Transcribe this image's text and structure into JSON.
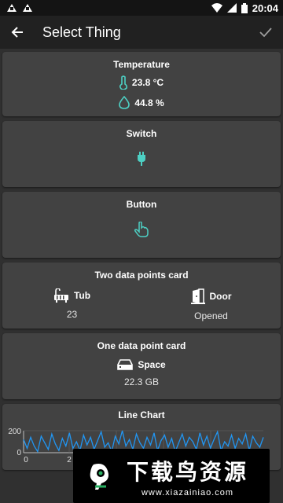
{
  "status_bar": {
    "time": "20:04"
  },
  "app_bar": {
    "title": "Select Thing",
    "back_icon": "arrow-left-icon",
    "confirm_icon": "check-icon"
  },
  "cards": {
    "temperature": {
      "title": "Temperature",
      "temp_value": "23.8 °C",
      "humidity_value": "44.8 %"
    },
    "switch": {
      "title": "Switch"
    },
    "button": {
      "title": "Button"
    },
    "two_points": {
      "title": "Two data points card",
      "left_label": "Tub",
      "left_value": "23",
      "right_label": "Door",
      "right_value": "Opened"
    },
    "one_point": {
      "title": "One data point card",
      "label": "Space",
      "value": "22.3 GB"
    },
    "line_chart": {
      "title": "Line Chart"
    }
  },
  "colors": {
    "accent": "#4dd0c4",
    "chart_line": "#2196f3"
  },
  "chart_data": {
    "type": "line",
    "title": "Line Chart",
    "ylim": [
      0,
      200
    ],
    "y_ticks": [
      "200",
      "0"
    ],
    "x_ticks": [
      "0",
      "2"
    ],
    "values": [
      120,
      40,
      140,
      60,
      10,
      150,
      90,
      30,
      170,
      80,
      20,
      130,
      60,
      180,
      40,
      100,
      20,
      160,
      70,
      140,
      30,
      110,
      190,
      50,
      90,
      10,
      150,
      80,
      200,
      60,
      120,
      30,
      170,
      90,
      40,
      140,
      70,
      180,
      20,
      110,
      160,
      50,
      130,
      10,
      90,
      170,
      60,
      140,
      100,
      30,
      180,
      70,
      150,
      40,
      120,
      190,
      20,
      100,
      60,
      160,
      40,
      130,
      80,
      170,
      20,
      150,
      90,
      50,
      140
    ]
  },
  "watermark": {
    "text": "下载鸟资源",
    "url": "www.xiazainiao.com"
  }
}
